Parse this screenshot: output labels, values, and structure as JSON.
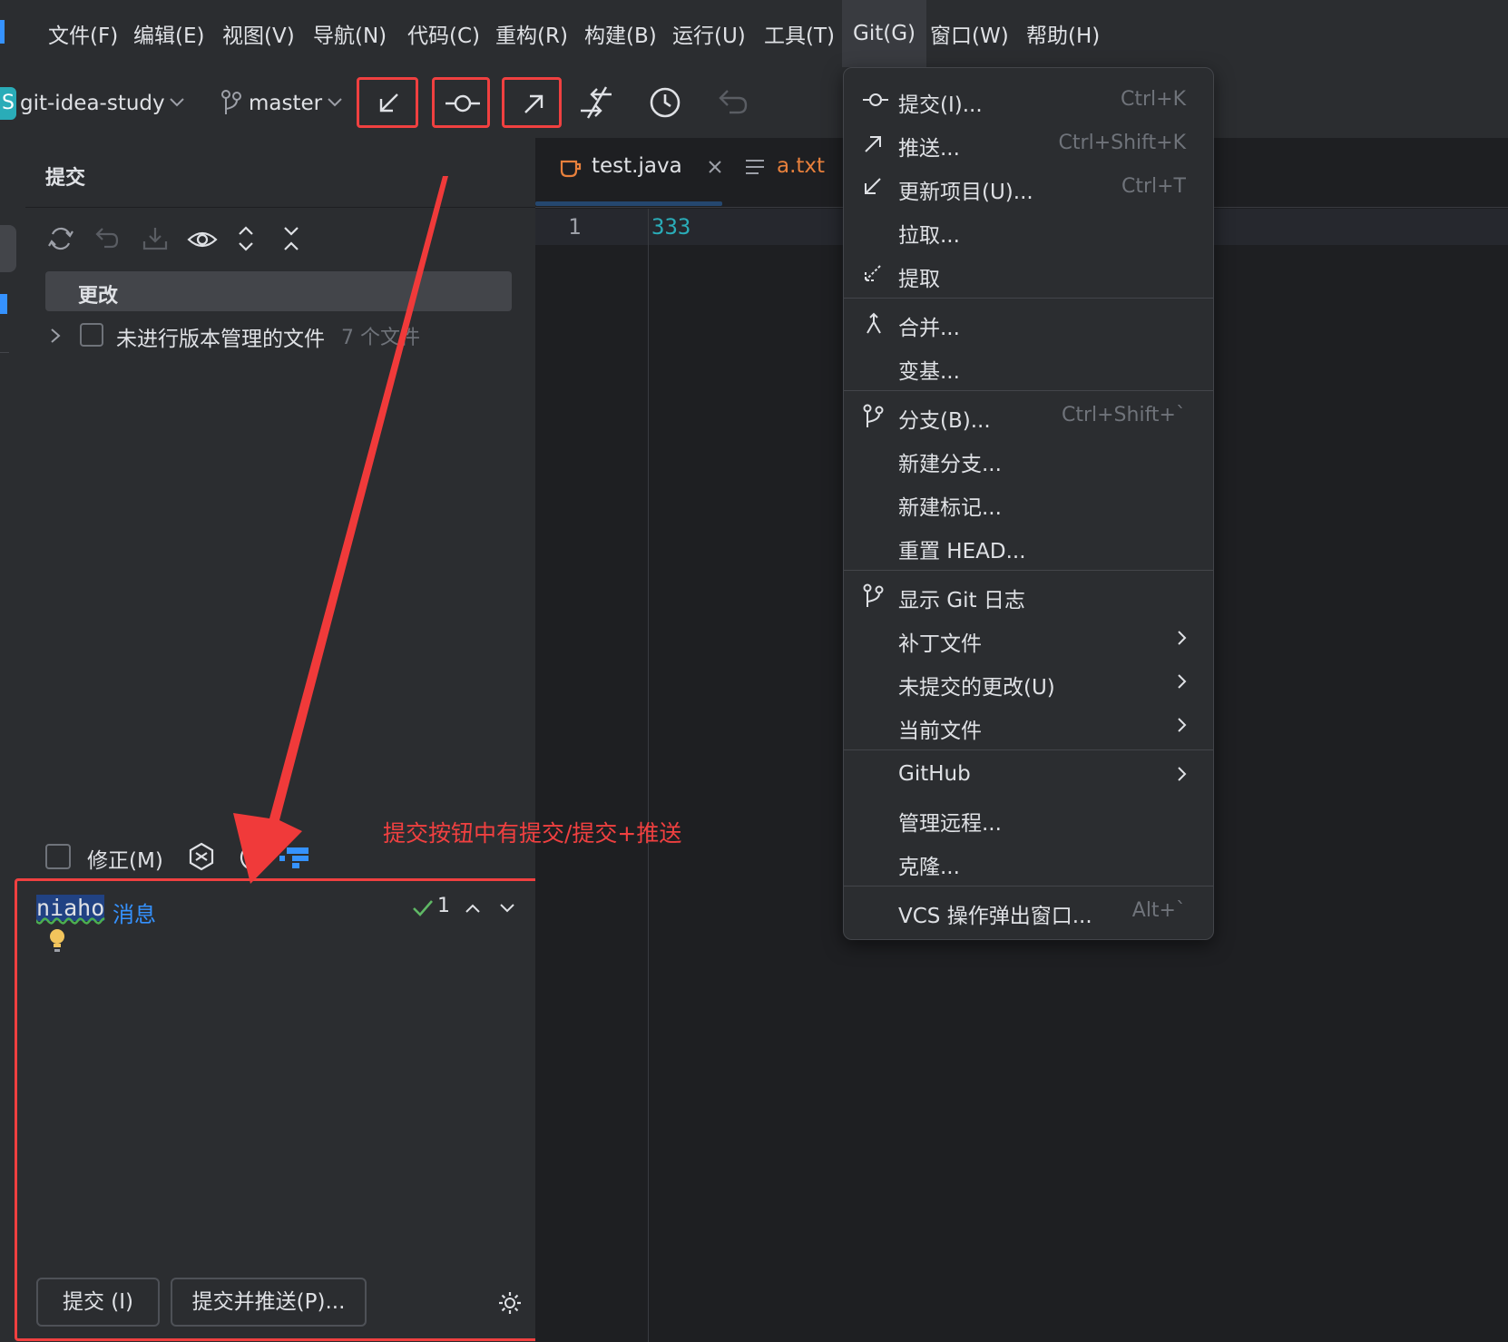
{
  "menubar": {
    "items": [
      "文件(F)",
      "编辑(E)",
      "视图(V)",
      "导航(N)",
      "代码(C)",
      "重构(R)",
      "构建(B)",
      "运行(U)",
      "工具(T)",
      "Git(G)",
      "窗口(W)",
      "帮助(H)"
    ]
  },
  "toolbar": {
    "project_initial": "S",
    "project_name": "git-idea-study",
    "branch": "master"
  },
  "annotations": {
    "pull": "拉取",
    "commit": "提交",
    "push": "推送",
    "note": "提交按钮中有提交/提交+推送"
  },
  "commit_panel": {
    "title": "提交",
    "changes_header": "更改",
    "unversioned_label": "未进行版本管理的文件",
    "unversioned_count": "7 个文件",
    "amend_label": "修正(M)",
    "message_text": "niaho",
    "message_placeholder": "消息",
    "check_count": "1",
    "commit_button": "提交 (I)",
    "commit_push_button": "提交并推送(P)..."
  },
  "editor": {
    "tabs": [
      {
        "label": "test.java",
        "active": true
      },
      {
        "label": "a.txt",
        "active": false
      }
    ],
    "line_number": "1",
    "line_text": "333"
  },
  "git_menu": {
    "items": [
      {
        "label": "提交(I)...",
        "shortcut": "Ctrl+K",
        "icon": "commit-icon"
      },
      {
        "label": "推送...",
        "shortcut": "Ctrl+Shift+K",
        "icon": "push-icon"
      },
      {
        "label": "更新项目(U)...",
        "shortcut": "Ctrl+T",
        "icon": "update-icon"
      },
      {
        "label": "拉取...",
        "shortcut": ""
      },
      {
        "label": "提取",
        "shortcut": "",
        "icon": "fetch-icon"
      },
      {
        "label": "合并...",
        "shortcut": "",
        "icon": "merge-icon"
      },
      {
        "label": "变基...",
        "shortcut": ""
      },
      {
        "label": "分支(B)...",
        "shortcut": "Ctrl+Shift+`",
        "icon": "branch-icon"
      },
      {
        "label": "新建分支...",
        "shortcut": ""
      },
      {
        "label": "新建标记...",
        "shortcut": ""
      },
      {
        "label": "重置 HEAD...",
        "shortcut": ""
      },
      {
        "label": "显示 Git 日志",
        "shortcut": "",
        "icon": "git-log-icon"
      },
      {
        "label": "补丁文件",
        "shortcut": "",
        "submenu": true
      },
      {
        "label": "未提交的更改(U)",
        "shortcut": "",
        "submenu": true
      },
      {
        "label": "当前文件",
        "shortcut": "",
        "submenu": true
      },
      {
        "label": "GitHub",
        "shortcut": "",
        "submenu": true
      },
      {
        "label": "管理远程...",
        "shortcut": ""
      },
      {
        "label": "克隆...",
        "shortcut": ""
      },
      {
        "label": "VCS 操作弹出窗口...",
        "shortcut": "Alt+`"
      }
    ]
  },
  "colors": {
    "accent": "#3592ff",
    "annotation_red": "#f04040",
    "code_number": "#2aacb8"
  }
}
